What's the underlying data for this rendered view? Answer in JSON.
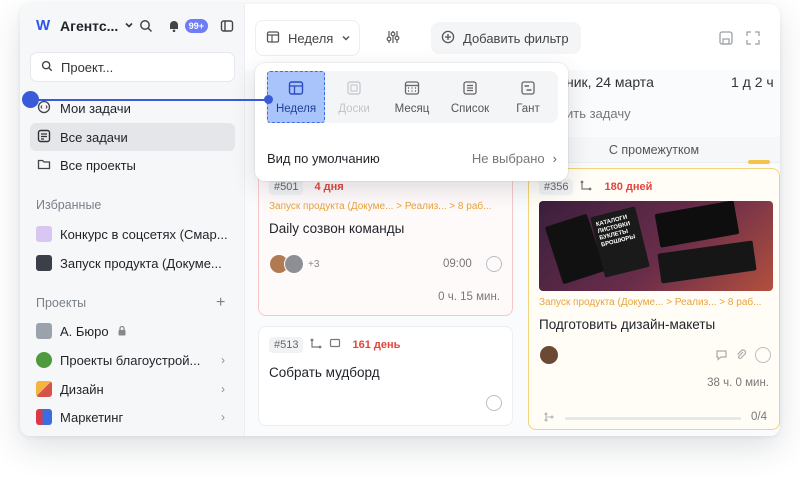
{
  "sidebar": {
    "workspace": "Агентс...",
    "notifications_badge": "99+",
    "search_placeholder": "Проект...",
    "nav": [
      {
        "label": "Мои задачи"
      },
      {
        "label": "Все задачи"
      },
      {
        "label": "Все проекты"
      }
    ],
    "favorites_title": "Избранные",
    "favorites": [
      {
        "label": "Конкурс в соцсетях (Смар..."
      },
      {
        "label": "Запуск продукта (Докуме..."
      }
    ],
    "projects_title": "Проекты",
    "projects": [
      {
        "label": "А. Бюро"
      },
      {
        "label": "Проекты благоустрой..."
      },
      {
        "label": "Дизайн"
      },
      {
        "label": "Маркетинг"
      }
    ]
  },
  "toolbar": {
    "view_label": "Неделя",
    "add_filter": "Добавить фильтр"
  },
  "popover": {
    "views": [
      {
        "label": "Неделя",
        "state": "selected"
      },
      {
        "label": "Доски",
        "state": "disabled"
      },
      {
        "label": "Месяц",
        "state": "normal"
      },
      {
        "label": "Список",
        "state": "normal"
      },
      {
        "label": "Гант",
        "state": "normal"
      }
    ],
    "default_label": "Вид по умолчанию",
    "default_value": "Не выбрано"
  },
  "board": {
    "date_header": "ник, 24 марта",
    "period": "1 д 2 ч",
    "add_task": "ить задачу",
    "column_title": "С промежутком",
    "cards": [
      {
        "id": "#501",
        "days": "4 дня",
        "crumb": "Запуск продукта (Докуме... > Реализ... > 8 раб...",
        "title": "Daily созвон команды",
        "extra": "+3",
        "time": "09:00",
        "duration": "0 ч. 15 мин."
      },
      {
        "id": "#513",
        "days": "161 день",
        "title": "Собрать мудборд"
      },
      {
        "id": "#356",
        "days": "180 дней",
        "crumb": "Запуск продукта (Докуме... > Реализ... > 8 раб...",
        "title": "Подготовить дизайн-макеты",
        "duration": "38 ч. 0 мин.",
        "progress": "0/4",
        "image_text": "КАТАЛОГИ ЛИСТОВКИ БУКЛЕТЫ БРОШЮРЫ"
      }
    ]
  },
  "colors": {
    "accent": "#3a5bd9",
    "selected_view": "#a9c4fb",
    "overdue": "#e2453c",
    "crumb": "#e8a33b"
  }
}
